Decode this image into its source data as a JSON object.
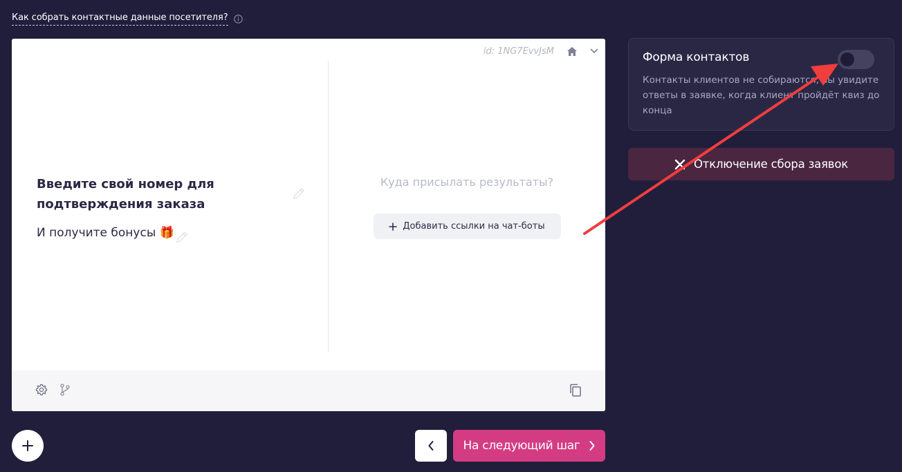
{
  "help": {
    "link_text": "Как собрать контактные данные посетителя?",
    "info_icon": "info-icon"
  },
  "card": {
    "id_text": "id: 1NG7EvvJsM",
    "home_icon": "home-icon",
    "chevron_icon": "chevron-down-icon",
    "question_title": "Введите свой номер для подтверждения заказа",
    "question_subtitle": "И получите бонусы 🎁",
    "results_question": "Куда присылать результаты?",
    "add_links_label": "Добавить ссылки на чат-боты",
    "footer_icons": [
      "gear-icon",
      "branch-icon",
      "copy-icon"
    ]
  },
  "nav": {
    "add_icon": "plus-icon",
    "back_icon": "chevron-left-icon",
    "next_label": "На следующий шаг",
    "next_icon": "chevron-right-icon"
  },
  "contact_form": {
    "title": "Форма контактов",
    "toggle_on": false,
    "description": "Контакты клиентов не собираются, вы увидите ответы в заявке, когда клиент пройдёт квиз до конца"
  },
  "disable_button": {
    "label": "Отключение сбора заявок",
    "icon": "close-icon"
  },
  "colors": {
    "background": "#211e3c",
    "accent": "#d33c83",
    "annotation_arrow": "#f03e3e"
  }
}
